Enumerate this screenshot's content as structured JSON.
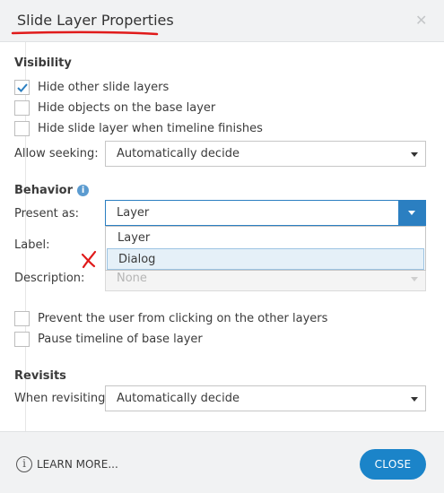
{
  "dialog": {
    "title": "Slide Layer Properties",
    "close_icon": "close-icon"
  },
  "visibility": {
    "heading": "Visibility",
    "options": [
      {
        "label": "Hide other slide layers",
        "checked": true
      },
      {
        "label": "Hide objects on the base layer",
        "checked": false
      },
      {
        "label": "Hide slide layer when timeline finishes",
        "checked": false
      }
    ],
    "allow_seeking_label": "Allow seeking:",
    "allow_seeking_value": "Automatically decide"
  },
  "behavior": {
    "heading": "Behavior",
    "info_icon": "info-icon",
    "present_as_label": "Present as:",
    "present_as_value": "Layer",
    "present_as_options": [
      "Layer",
      "Dialog"
    ],
    "label_label": "Label:",
    "description_label": "Description:",
    "description_value": "None",
    "options": [
      {
        "label": "Prevent the user from clicking on the other layers",
        "checked": false
      },
      {
        "label": "Pause timeline of base layer",
        "checked": false
      }
    ]
  },
  "revisits": {
    "heading": "Revisits",
    "when_revisiting_label": "When revisiting:",
    "when_revisiting_value": "Automatically decide"
  },
  "footer": {
    "learn_more": "LEARN MORE...",
    "close_button": "CLOSE",
    "info_glyph": "i"
  },
  "colors": {
    "accent": "#1b84c9",
    "annotation_red": "#e01a1a"
  }
}
